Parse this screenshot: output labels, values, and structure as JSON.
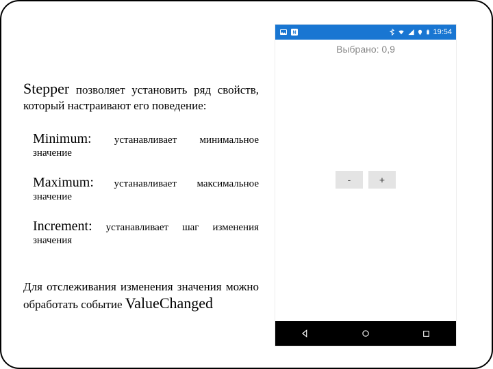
{
  "text": {
    "intro_lead": "Stepper",
    "intro_rest": " позволяет установить ряд свойств, который настраивают его поведение:",
    "items": [
      {
        "name": "Minimum:",
        "desc": " устанавливает минимальное значение"
      },
      {
        "name": "Maximum:",
        "desc": " устанавливает максимальное значение"
      },
      {
        "name": "Increment:",
        "desc": " устанавливает шаг изменения значения"
      }
    ],
    "outro_a": "Для отслеживания изменения значения можно обработать событие ",
    "outro_b": "ValueChanged"
  },
  "phone": {
    "statusbar": {
      "time": "19:54"
    },
    "app": {
      "selected_label": "Выбрано: 0,9",
      "minus_label": "-",
      "plus_label": "+"
    }
  }
}
